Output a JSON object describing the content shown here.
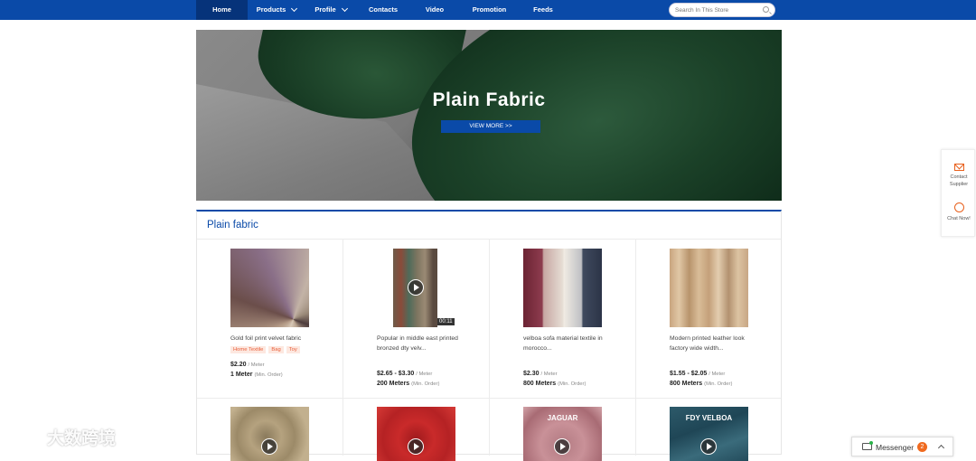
{
  "nav": {
    "items": [
      {
        "label": "Home",
        "active": true,
        "dropdown": false
      },
      {
        "label": "Products",
        "active": false,
        "dropdown": true
      },
      {
        "label": "Profile",
        "active": false,
        "dropdown": true
      },
      {
        "label": "Contacts",
        "active": false,
        "dropdown": false
      },
      {
        "label": "Video",
        "active": false,
        "dropdown": false
      },
      {
        "label": "Promotion",
        "active": false,
        "dropdown": false
      },
      {
        "label": "Feeds",
        "active": false,
        "dropdown": false
      }
    ],
    "search_placeholder": "Search In This Store"
  },
  "banner": {
    "title": "Plain Fabric",
    "button": "VIEW MORE >>"
  },
  "section": {
    "title": "Plain fabric"
  },
  "products": [
    {
      "name": "Gold foil print velvet fabric",
      "tags": [
        "Home Textile",
        "Bag",
        "Toy"
      ],
      "price": "$2.20",
      "unit": "/ Meter",
      "moq": "1 Meter",
      "moq_note": "(Min. Order)",
      "video": false
    },
    {
      "name": "Popular in middle east printed bronzed dty velv...",
      "tags": [],
      "price": "$2.65 - $3.30",
      "unit": "/ Meter",
      "moq": "200 Meters",
      "moq_note": "(Min. Order)",
      "video": true,
      "duration": "00:11"
    },
    {
      "name": "velboa sofa material textile in morocco...",
      "tags": [],
      "price": "$2.30",
      "unit": "/ Meter",
      "moq": "800 Meters",
      "moq_note": "(Min. Order)",
      "video": false
    },
    {
      "name": "Modern printed leather look factory wide width...",
      "tags": [],
      "price": "$1.55 - $2.05",
      "unit": "/ Meter",
      "moq": "800 Meters",
      "moq_note": "(Min. Order)",
      "video": false
    }
  ],
  "row2": [
    {
      "overlay": "",
      "video": true
    },
    {
      "overlay": "",
      "video": true
    },
    {
      "overlay": "JAGUAR",
      "video": true
    },
    {
      "overlay": "FDY VELBOA",
      "video": true
    }
  ],
  "side": {
    "contact": "Contact Supplier",
    "chat": "Chat Now!"
  },
  "messenger": {
    "label": "Messenger",
    "count": "2"
  },
  "watermark": {
    "text": "大数跨境"
  },
  "colors": {
    "brand": "#0a4aa8",
    "accent": "#e8601c"
  }
}
